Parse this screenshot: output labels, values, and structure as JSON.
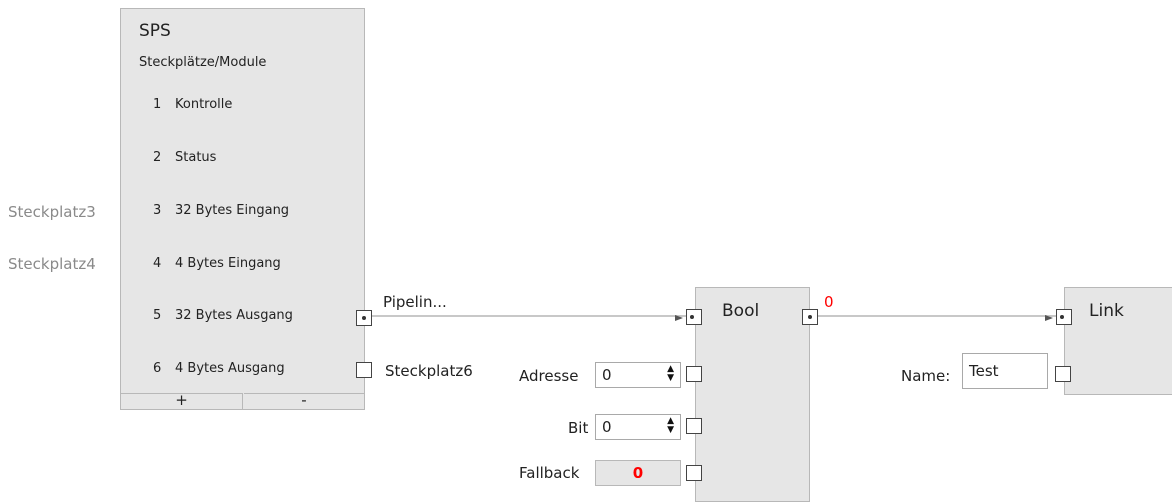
{
  "sps": {
    "title": "SPS",
    "subtitle": "Steckplätze/Module",
    "slots": [
      {
        "num": "1",
        "label": "Kontrolle"
      },
      {
        "num": "2",
        "label": "Status"
      },
      {
        "num": "3",
        "label": "32 Bytes Eingang"
      },
      {
        "num": "4",
        "label": "4 Bytes Eingang"
      },
      {
        "num": "5",
        "label": "32 Bytes Ausgang"
      },
      {
        "num": "6",
        "label": "4 Bytes Ausgang"
      }
    ],
    "add_button": "+",
    "remove_button": "-"
  },
  "external_labels": {
    "slot3": "Steckplatz3",
    "slot4": "Steckplatz4"
  },
  "outputs": {
    "slot5_wire_label": "Pipelin...",
    "slot6_label": "Steckplatz6"
  },
  "bool_node": {
    "title": "Bool",
    "output_value": "0",
    "adresse_label": "Adresse",
    "adresse_value": "0",
    "bit_label": "Bit",
    "bit_value": "0",
    "fallback_label": "Fallback",
    "fallback_value": "0"
  },
  "link_node": {
    "title": "Link",
    "name_label": "Name:",
    "name_value": "Test"
  },
  "colors": {
    "node_bg": "#e6e6e6",
    "value_red": "#ff0000",
    "wire": "#c8c8c8"
  }
}
